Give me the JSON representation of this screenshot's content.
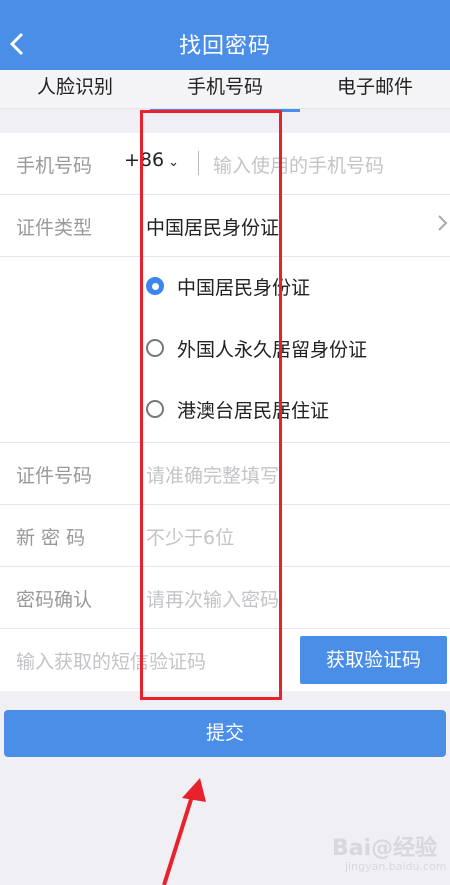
{
  "header": {
    "title": "找回密码",
    "back_icon": "chevron-left-icon"
  },
  "tabs": [
    {
      "label": "人脸识别",
      "active": false
    },
    {
      "label": "手机号码",
      "active": true
    },
    {
      "label": "电子邮件",
      "active": false
    }
  ],
  "form": {
    "phone": {
      "label": "手机号码",
      "country_code": "+86",
      "placeholder": "输入使用的手机号码"
    },
    "id_type": {
      "label": "证件类型",
      "value": "中国居民身份证",
      "options": [
        {
          "label": "中国居民身份证",
          "checked": true
        },
        {
          "label": "外国人永久居留身份证",
          "checked": false
        },
        {
          "label": "港澳台居民居住证",
          "checked": false
        }
      ]
    },
    "id_number": {
      "label": "证件号码",
      "placeholder": "请准确完整填写"
    },
    "new_password": {
      "label": "新 密 码",
      "placeholder": "不少于6位"
    },
    "confirm_password": {
      "label": "密码确认",
      "placeholder": "请再次输入密码"
    },
    "sms": {
      "placeholder": "输入获取的短信验证码",
      "button": "获取验证码"
    }
  },
  "submit": {
    "label": "提交"
  },
  "watermark": {
    "text": "Bai@经验",
    "sub": "jingyan.baidu.com"
  },
  "colors": {
    "accent": "#4a8ee8",
    "annotation": "#e8222c",
    "radio_checked": "#3c86f0"
  }
}
